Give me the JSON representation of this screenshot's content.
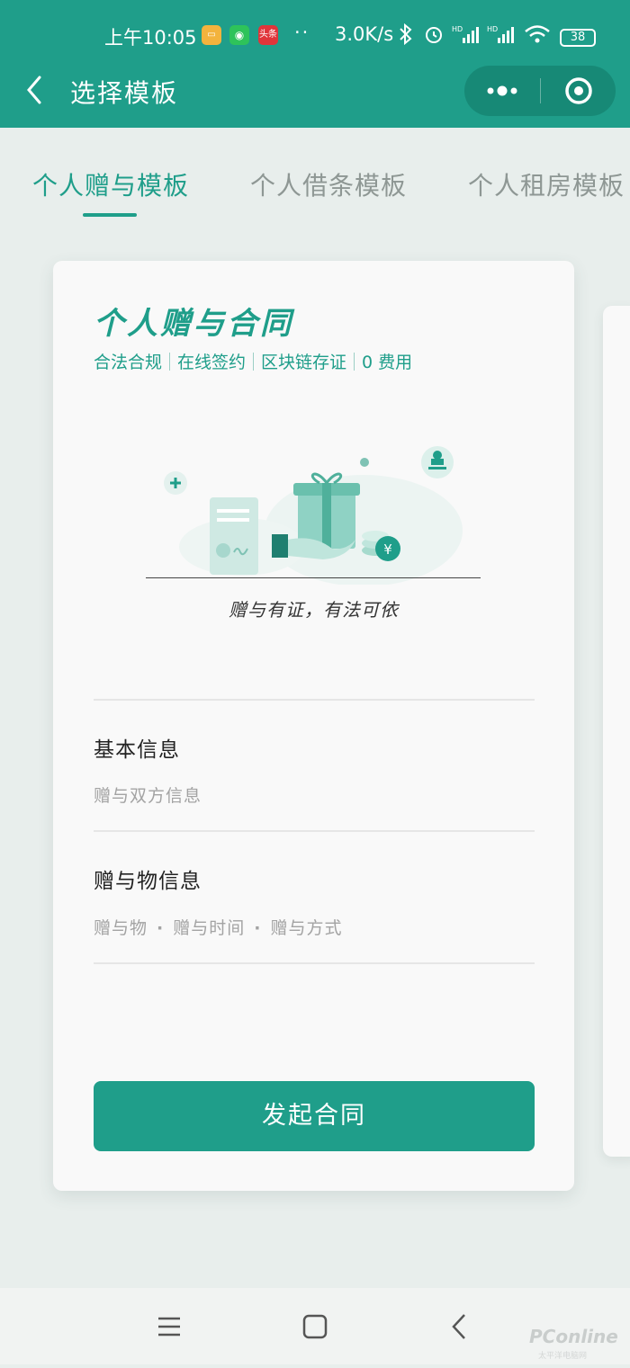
{
  "status_bar": {
    "time": "上午10:05",
    "badge_news": "头条",
    "dots": "··",
    "net_speed": "3.0K/s",
    "signal1_label": "HD",
    "signal2_label": "HD",
    "battery": "38",
    "icons": [
      "notes-app-icon",
      "wechat-icon",
      "toutiao-icon",
      "bluetooth-icon",
      "alarm-icon",
      "signal-icon",
      "signal-icon",
      "wifi-icon",
      "battery-icon"
    ]
  },
  "nav": {
    "title": "选择模板",
    "back_icon": "chevron-left-icon",
    "more_icon": "more-dots-icon",
    "close_icon": "target-close-icon"
  },
  "tabs": [
    {
      "label": "个人赠与模板",
      "active": true
    },
    {
      "label": "个人借条模板",
      "active": false
    },
    {
      "label": "个人租房模板",
      "active": false
    }
  ],
  "card": {
    "title": "个人赠与合同",
    "features": [
      "合法合规",
      "在线签约",
      "区块链存证",
      "0 费用"
    ],
    "caption": "赠与有证，有法可依",
    "sections": [
      {
        "title": "基本信息",
        "subtitle_items": [
          "赠与双方信息"
        ]
      },
      {
        "title": "赠与物信息",
        "subtitle_items": [
          "赠与物",
          "赠与时间",
          "赠与方式"
        ]
      }
    ],
    "button": "发起合同"
  },
  "watermark": {
    "text": "PConline",
    "sub": "太平洋电脑网"
  },
  "colors": {
    "accent": "#1f9e8a",
    "accent_dark": "#178976",
    "background": "#e8eeec"
  }
}
